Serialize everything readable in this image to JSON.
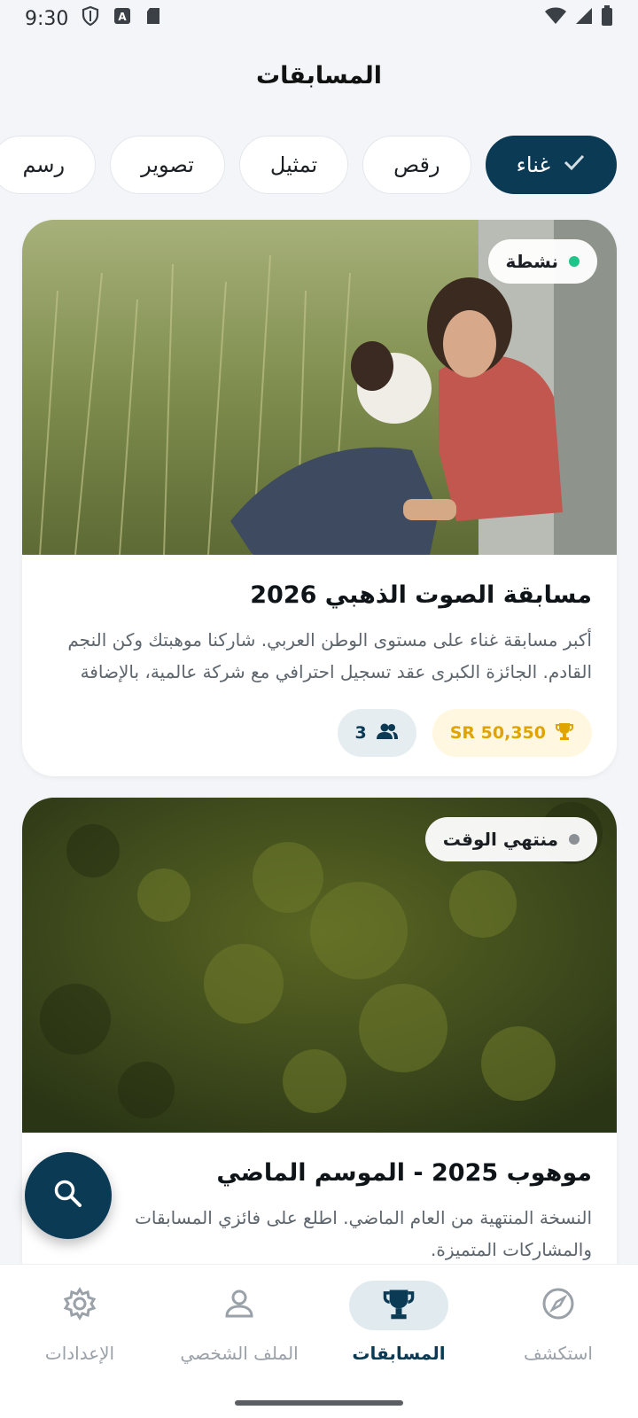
{
  "status_bar": {
    "time": "9:30",
    "icons": [
      "shield-icon",
      "a-square-icon",
      "sd-card-icon",
      "wifi-icon",
      "signal-icon",
      "battery-icon"
    ]
  },
  "header": {
    "title": "المسابقات"
  },
  "chips": [
    {
      "label": "غناء",
      "selected": true
    },
    {
      "label": "رقص",
      "selected": false
    },
    {
      "label": "تمثيل",
      "selected": false
    },
    {
      "label": "تصوير",
      "selected": false
    },
    {
      "label": "رسم",
      "selected": false
    }
  ],
  "cards": [
    {
      "status": "نشطة",
      "status_color": "#1fc48a",
      "title": "مسابقة الصوت الذهبي 2026",
      "description": "أكبر مسابقة غناء على مستوى الوطن العربي. شاركنا موهبتك وكن النجم القادم. الجائزة الكبرى عقد تسجيل احترافي مع شركة عالمية، بالإضافة إل...",
      "prize": "SR 50,350",
      "participants": "3"
    },
    {
      "status": "منتهي الوقت",
      "status_color": "#8b9096",
      "title": "موهوب 2025 - الموسم الماضي",
      "description": "النسخة المنتهية من العام الماضي. اطلع على فائزي المسابقات والمشاركات المتميزة."
    }
  ],
  "bottom_nav": [
    {
      "label": "استكشف",
      "icon": "compass-icon",
      "active": false
    },
    {
      "label": "المسابقات",
      "icon": "trophy-icon",
      "active": true
    },
    {
      "label": "الملف الشخصي",
      "icon": "person-icon",
      "active": false
    },
    {
      "label": "الإعدادات",
      "icon": "gear-icon",
      "active": false
    }
  ],
  "colors": {
    "primary": "#0b3a55",
    "prize_text": "#e0a400",
    "prize_bg": "#fff7e0",
    "active_dot": "#1fc48a",
    "ended_dot": "#8b9096"
  }
}
